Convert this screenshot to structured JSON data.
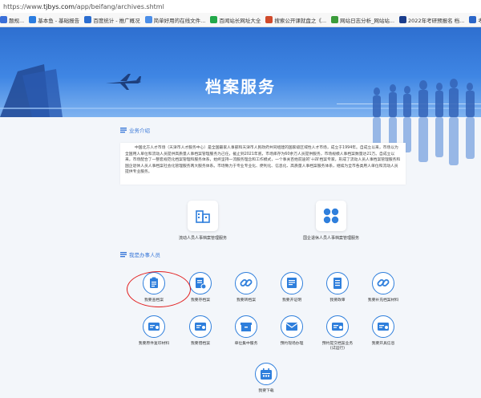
{
  "browser": {
    "url_prefix": "https://www.",
    "url_host": "tjbys.com",
    "url_path": "/app/beifang/archives.shtml",
    "bookmarks": [
      {
        "label": "题规...",
        "color": "#3a6fd8"
      },
      {
        "label": "基本鱼 - 基础报告",
        "color": "#2b7de0"
      },
      {
        "label": "百度统计 - 推广概况",
        "color": "#2b6dd0"
      },
      {
        "label": "简单好用的在线文件...",
        "color": "#4b8ee8"
      },
      {
        "label": "百闻站长网址大全",
        "color": "#22a84a"
      },
      {
        "label": "搜索公开课就盘之《...",
        "color": "#d04a2b"
      },
      {
        "label": "网站日志分析_网站站...",
        "color": "#3b9c3b"
      },
      {
        "label": "2022年考研预报名 档...",
        "color": "#1a3d8c"
      },
      {
        "label": "考研档案查询",
        "color": "#2b66c8"
      }
    ]
  },
  "banner": {
    "title": "档案服务"
  },
  "intro": {
    "heading": "业务介绍",
    "text": "中国北方人才市场（天津市人才服务中心）是全国最家人事部和天津市人民政府共同组建的国家级区域性人才市场，成立于1994年。自成立以来，市场以为全国用人单位和流动人员提供高质量人事档案管理服务为己任，截止到2021年底，市场库存为60余万人员提供服务，市场规模人事档案数量达21万。自成立以来，市场配合了一整套规范化档案管理和服务体系，始终坚持一流服务理念和工作模式，一个事关百姓前途的'十四'档案专家，形成了流动人员人事档案管理服务和国企退休人员人事档案社会化管理服务两大服务体系。市场致力于专业专业化、便利化、信息化、高质量人事档案服务体系，继续为全市各类用人单位和流动人员提供专业服务。"
  },
  "big_cards": [
    {
      "label": "流动人员人事档案管理服务",
      "icon": "building-icon"
    },
    {
      "label": "国企退休人员人事档案管理服务",
      "icon": "grid-four-icon"
    }
  ],
  "services": {
    "heading": "我是办事人员",
    "row1": [
      {
        "label": "我要查档案",
        "icon": "clipboard-icon"
      },
      {
        "label": "我要存档案",
        "icon": "document-stamp-icon"
      },
      {
        "label": "我要转档案",
        "icon": "link-icon"
      },
      {
        "label": "我要开证明",
        "icon": "certificate-icon"
      },
      {
        "label": "我要政审",
        "icon": "document-list-icon"
      },
      {
        "label": "我要补充档案材料",
        "icon": "link-icon"
      }
    ],
    "row2": [
      {
        "label": "我要原件复印材料",
        "icon": "card-icon"
      },
      {
        "label": "我要借档案",
        "icon": "card-icon"
      },
      {
        "label": "单位集中服务",
        "icon": "archive-box-icon"
      },
      {
        "label": "预约现场办理",
        "icon": "envelope-check-icon"
      },
      {
        "label": "预约提交档案业务\n(试运行)",
        "icon": "card-icon"
      },
      {
        "label": "我要开具信息",
        "icon": "card-icon"
      }
    ],
    "row3": [
      {
        "label": "我要下载",
        "icon": "calendar-icon"
      }
    ]
  },
  "colors": {
    "accent": "#2f7fdc",
    "highlight": "#e21d1d"
  }
}
